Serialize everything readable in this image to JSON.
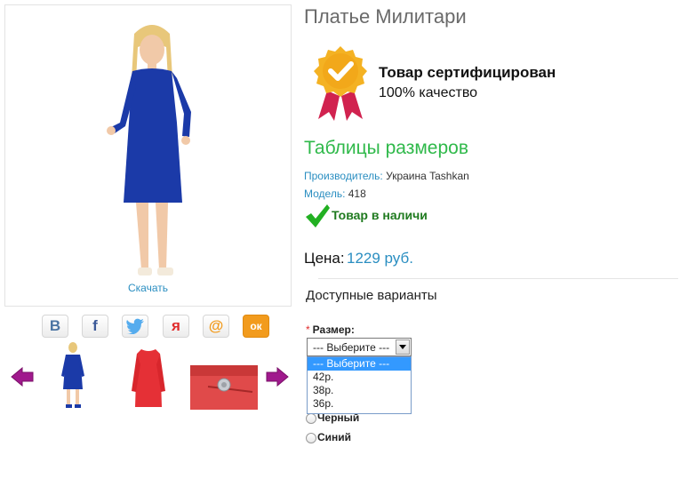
{
  "product": {
    "title": "Платье Милитари",
    "download_label": "Скачать",
    "certificate": {
      "title": "Товар сертифицирован",
      "subtitle": "100% качество"
    },
    "size_tables_link": "Таблицы размеров",
    "manufacturer": {
      "label": "Производитель:",
      "value": "Украина Tashkan"
    },
    "model": {
      "label": "Модель:",
      "value": "418"
    },
    "stock_status": "Товар в наличи",
    "price": {
      "label": "Цена:",
      "value": "1229 руб."
    },
    "variants_heading": "Доступные варианты",
    "size_option": {
      "required_mark": "*",
      "label": "Размер:",
      "selected": "--- Выберите ---",
      "options": [
        "--- Выберите ---",
        "42р.",
        "38р.",
        "36р."
      ]
    },
    "colors": [
      "Черный",
      "Синий"
    ]
  },
  "social": [
    {
      "icon": "vk-icon",
      "glyph": "В",
      "color": "#4c75a3"
    },
    {
      "icon": "facebook-icon",
      "glyph": "f",
      "color": "#3b5998"
    },
    {
      "icon": "twitter-icon",
      "glyph": "",
      "color": "#55acee"
    },
    {
      "icon": "moimir-icon",
      "glyph": "я",
      "color": "#e02b2b"
    },
    {
      "icon": "mailru-icon",
      "glyph": "@",
      "color": "#f29b1d"
    },
    {
      "icon": "odnoklassniki-icon",
      "glyph": "ок",
      "color": "#ffffff"
    }
  ],
  "colors": {
    "link": "#2a8ec1",
    "accent_green": "#2fb94a",
    "arrow": "#a0198d",
    "dress_blue": "#1b3aa8",
    "dress_red": "#e53036"
  }
}
